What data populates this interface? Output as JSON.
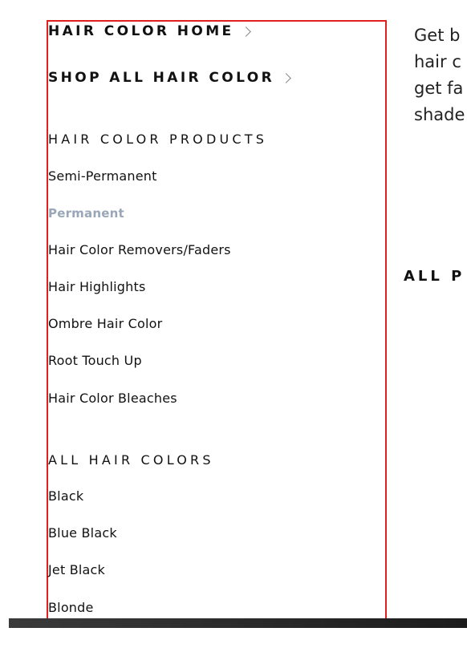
{
  "nav": {
    "home_link": "HAIR COLOR HOME",
    "shop_all_link": "SHOP ALL HAIR COLOR",
    "products_heading": "HAIR COLOR PRODUCTS",
    "products": [
      {
        "label": "Semi-Permanent",
        "active": false
      },
      {
        "label": "Permanent",
        "active": true
      },
      {
        "label": "Hair Color Removers/Faders",
        "active": false
      },
      {
        "label": "Hair Highlights",
        "active": false
      },
      {
        "label": "Ombre Hair Color",
        "active": false
      },
      {
        "label": "Root Touch Up",
        "active": false
      },
      {
        "label": "Hair Color Bleaches",
        "active": false
      }
    ],
    "colors_heading": "ALL HAIR COLORS",
    "colors": [
      {
        "label": "Black"
      },
      {
        "label": "Blue Black"
      },
      {
        "label": "Jet Black"
      },
      {
        "label": "Blonde"
      }
    ]
  },
  "content": {
    "intro_lines": [
      "Get b",
      "hair c",
      "get fa",
      "shade"
    ],
    "section_heading": "ALL P"
  },
  "colors": {
    "panel_border": "#e0201f",
    "active_item": "#9aa7b8",
    "text": "#111111"
  }
}
